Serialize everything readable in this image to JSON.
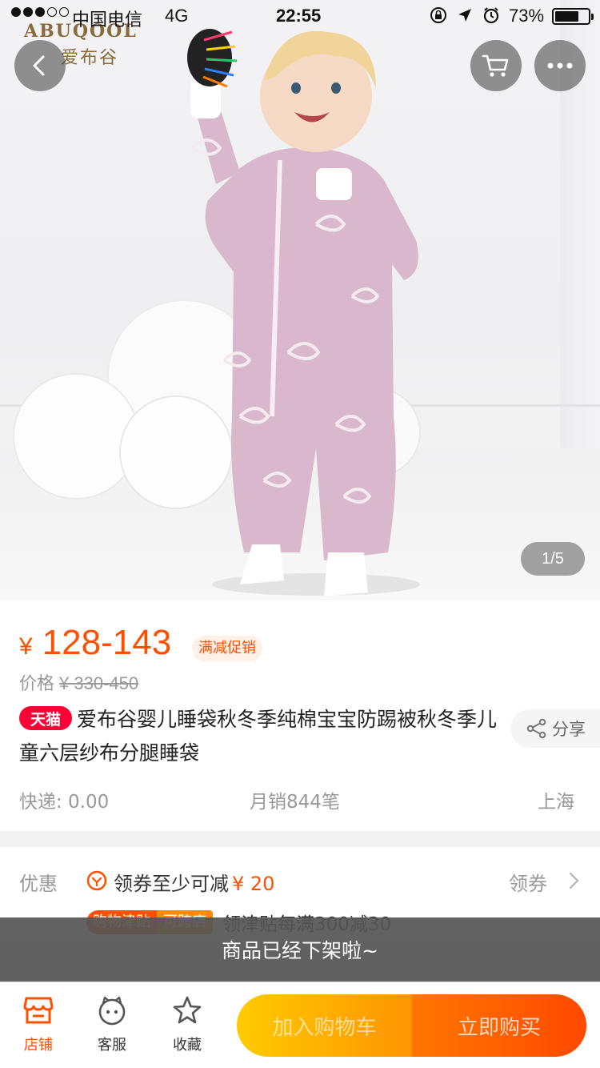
{
  "status_bar": {
    "carrier": "中国电信",
    "network": "4G",
    "time": "22:55",
    "battery_percent": "73%",
    "battery_level": 0.73,
    "signal_dots_filled": 3
  },
  "hero": {
    "brand_en": "ABUQOOL",
    "brand_cn": "爱布谷",
    "page_indicator": "1/5",
    "icons": {
      "back": "chevron-left-icon",
      "cart": "cart-icon",
      "more": "more-dots-icon"
    }
  },
  "product": {
    "currency": "¥",
    "price_range": "128-143",
    "promo_tag": "满减促销",
    "original_price_label": "价格",
    "original_price": "¥ 330-450",
    "store_badge": "天猫",
    "title": "爱布谷婴儿睡袋秋冬季纯棉宝宝防踢被秋冬季儿童六层纱布分腿睡袋",
    "share_label": "分享",
    "shipping": "快递: 0.00",
    "monthly_sales": "月销844笔",
    "location": "上海"
  },
  "coupon": {
    "label": "优惠",
    "text": "领券至少可减",
    "amount": "¥ 20",
    "action": "领券",
    "row2_badge": "购物津贴",
    "row2_badge2": "可跨店",
    "row2_text": "领津贴每满300减30"
  },
  "toast": {
    "message": "商品已经下架啦~"
  },
  "bottom_bar": {
    "store_label": "店铺",
    "service_label": "客服",
    "favorite_label": "收藏",
    "add_to_cart": "加入购物车",
    "buy_now": "立即购买"
  },
  "colors": {
    "accent": "#ff5000",
    "tmall_red": "#ff0036",
    "cart_gradient": [
      "#ffcb00",
      "#ff9402"
    ],
    "buy_gradient": [
      "#ff7700",
      "#ff4900"
    ]
  }
}
